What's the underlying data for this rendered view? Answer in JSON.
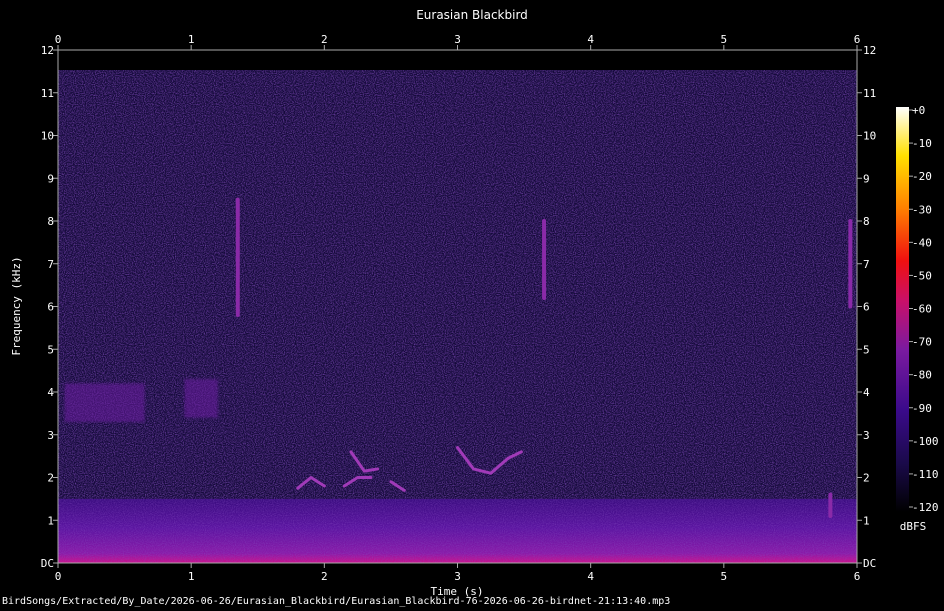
{
  "chart_data": {
    "type": "heatmap",
    "title": "Eurasian Blackbird",
    "xlabel": "Time (s)",
    "ylabel": "Frequency (kHz)",
    "xlim": [
      0,
      6
    ],
    "ylim": [
      0,
      12
    ],
    "x_ticks": [
      "0",
      "1",
      "2",
      "3",
      "4",
      "5",
      "6"
    ],
    "y_ticks": [
      "DC",
      "1",
      "2",
      "3",
      "4",
      "5",
      "6",
      "7",
      "8",
      "9",
      "10",
      "11",
      "12"
    ],
    "colorbar": {
      "label": "dBFS",
      "ticks": [
        "+0",
        "-10",
        "-20",
        "-30",
        "-40",
        "-50",
        "-60",
        "-70",
        "-80",
        "-90",
        "-100",
        "-110",
        "-120"
      ],
      "range": [
        -120,
        0
      ],
      "colors": [
        "#000000",
        "#1a0a4a",
        "#3a0a8a",
        "#7a1aa0",
        "#c8106a",
        "#f01010",
        "#ff8000",
        "#ffe000",
        "#ffffff"
      ]
    },
    "background_level_dbfs": -105,
    "low_band": {
      "freq_top_khz": 1.5,
      "level_dbfs": -80
    },
    "calls": [
      {
        "name": "chirp",
        "points": [
          [
            1.8,
            1.75
          ],
          [
            1.9,
            2.0
          ],
          [
            2.0,
            1.8
          ]
        ]
      },
      {
        "name": "chirp",
        "points": [
          [
            2.15,
            1.8
          ],
          [
            2.25,
            2.0
          ],
          [
            2.35,
            2.0
          ]
        ]
      },
      {
        "name": "chirp",
        "points": [
          [
            2.2,
            2.6
          ],
          [
            2.3,
            2.15
          ],
          [
            2.4,
            2.2
          ]
        ]
      },
      {
        "name": "chirp",
        "points": [
          [
            2.5,
            1.9
          ],
          [
            2.6,
            1.7
          ]
        ]
      },
      {
        "name": "chirp",
        "points": [
          [
            3.0,
            2.7
          ],
          [
            3.12,
            2.2
          ],
          [
            3.25,
            2.1
          ],
          [
            3.38,
            2.45
          ],
          [
            3.48,
            2.6
          ]
        ]
      },
      {
        "name": "band",
        "points": [
          [
            1.35,
            8.5
          ],
          [
            1.35,
            5.8
          ]
        ]
      },
      {
        "name": "band",
        "points": [
          [
            3.65,
            8.0
          ],
          [
            3.65,
            6.2
          ]
        ]
      },
      {
        "name": "band",
        "points": [
          [
            5.95,
            8.0
          ],
          [
            5.95,
            6.0
          ]
        ]
      },
      {
        "name": "pulse",
        "points": [
          [
            5.8,
            1.6
          ],
          [
            5.8,
            1.1
          ]
        ]
      },
      {
        "name": "cluster",
        "points": [
          [
            0.05,
            4.2
          ],
          [
            0.65,
            3.3
          ]
        ]
      },
      {
        "name": "cluster",
        "points": [
          [
            0.95,
            4.3
          ],
          [
            1.2,
            3.4
          ]
        ]
      }
    ]
  },
  "footer": {
    "file_path": "BirdSongs/Extracted/By_Date/2026-06-26/Eurasian_Blackbird/Eurasian_Blackbird-76-2026-06-26-birdnet-21:13:40.mp3"
  }
}
